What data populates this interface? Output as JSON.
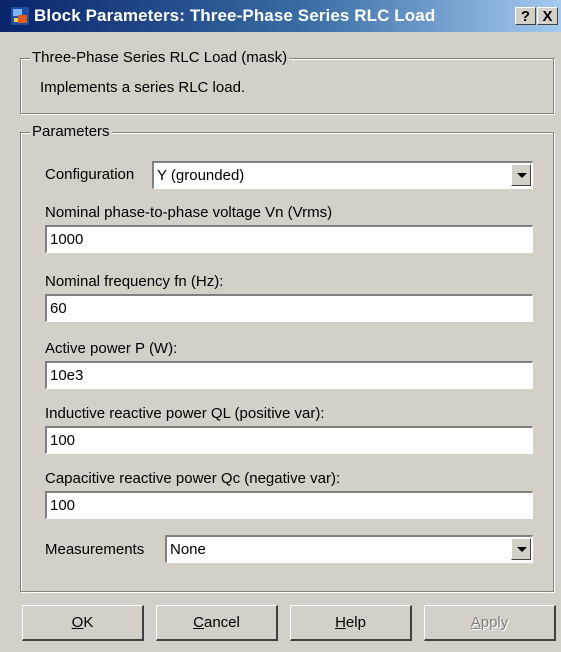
{
  "window": {
    "title": "Block Parameters: Three-Phase Series RLC Load",
    "help_button": "?",
    "close_button": "X"
  },
  "mask": {
    "legend": "Three-Phase Series RLC Load (mask)",
    "description": "Implements a series RLC load."
  },
  "parameters": {
    "legend": "Parameters",
    "configuration": {
      "label": "Configuration",
      "value": "Y (grounded)"
    },
    "nominal_voltage": {
      "label": "Nominal phase-to-phase voltage Vn (Vrms)",
      "value": "1000"
    },
    "nominal_frequency": {
      "label": "Nominal frequency fn (Hz):",
      "value": "60"
    },
    "active_power": {
      "label": "Active power P (W):",
      "value": "10e3"
    },
    "inductive_power": {
      "label": "Inductive reactive power QL (positive var):",
      "value": "100"
    },
    "capacitive_power": {
      "label": "Capacitive reactive power Qc (negative var):",
      "value": "100"
    },
    "measurements": {
      "label": "Measurements",
      "value": "None"
    }
  },
  "buttons": {
    "ok": {
      "mnemonic": "O",
      "rest": "K"
    },
    "cancel": {
      "mnemonic": "C",
      "rest": "ancel"
    },
    "help": {
      "mnemonic": "H",
      "rest": "elp"
    },
    "apply": {
      "mnemonic": "A",
      "rest": "pply"
    }
  },
  "colors": {
    "face": "#d4d0c8",
    "title_start": "#0a246a",
    "title_end": "#a6caf0",
    "disabled_text": "#808080"
  }
}
